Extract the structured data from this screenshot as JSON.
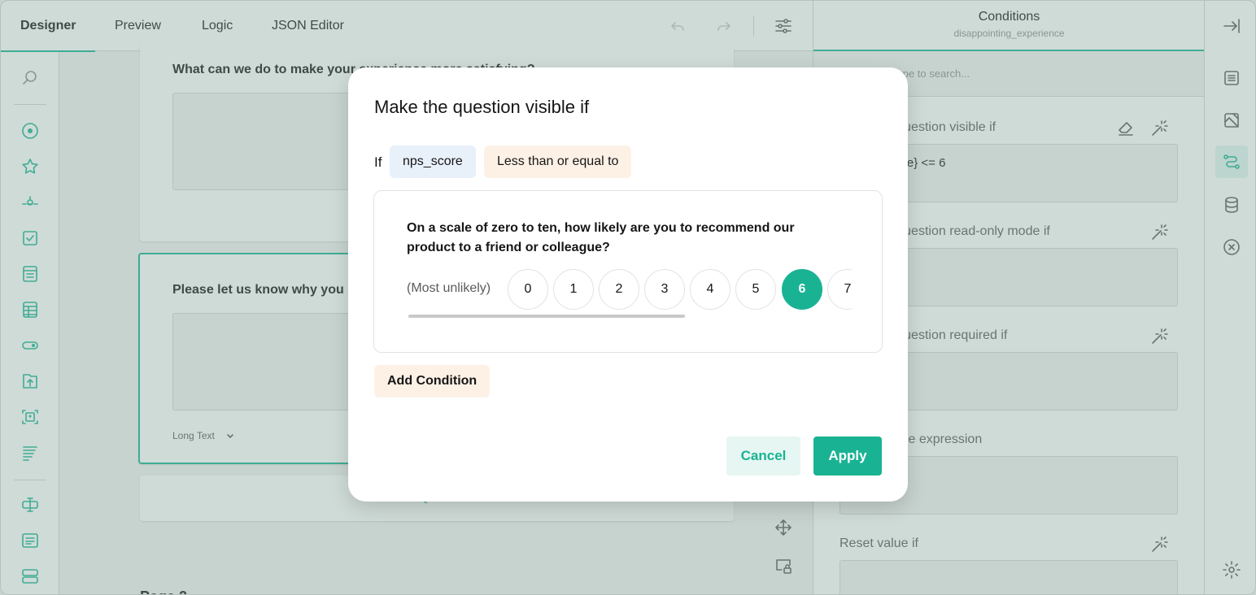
{
  "topbar": {
    "tabs": [
      "Designer",
      "Preview",
      "Logic",
      "JSON Editor"
    ]
  },
  "canvas": {
    "q1_title": "What can we do to make your experience more satisfying?",
    "q2_title": "Please let us know why you had such a disappointing experience with our product",
    "q2_type": "Long Text",
    "add_question": "Add Question",
    "page_label": "Page 2"
  },
  "right_panel": {
    "title": "Conditions",
    "subtitle": "disappointing_experience",
    "search_placeholder": "Type to search...",
    "visible_if_label": "Make the question visible if",
    "visible_if_value": "{nps_score} <= 6",
    "readonly_label": "Make the question read-only mode if",
    "required_label": "Make the question required if",
    "default_value_label": "Default value expression",
    "reset_label": "Reset value if"
  },
  "modal": {
    "title": "Make the question visible if",
    "if_label": "If",
    "question_chip": "nps_score",
    "operator_chip": "Less than or equal to",
    "question_text": "On a scale of zero to ten, how likely are you to recommend our product to a friend or colleague?",
    "min_label": "(Most unlikely)",
    "rating_values": [
      "0",
      "1",
      "2",
      "3",
      "4",
      "5",
      "6",
      "7"
    ],
    "selected_value": "6",
    "add_condition": "Add Condition",
    "cancel": "Cancel",
    "apply": "Apply"
  },
  "colors": {
    "accent": "#19b394",
    "chip_question_bg": "#e8f0fa",
    "chip_operator_bg": "#fdf1e6"
  }
}
